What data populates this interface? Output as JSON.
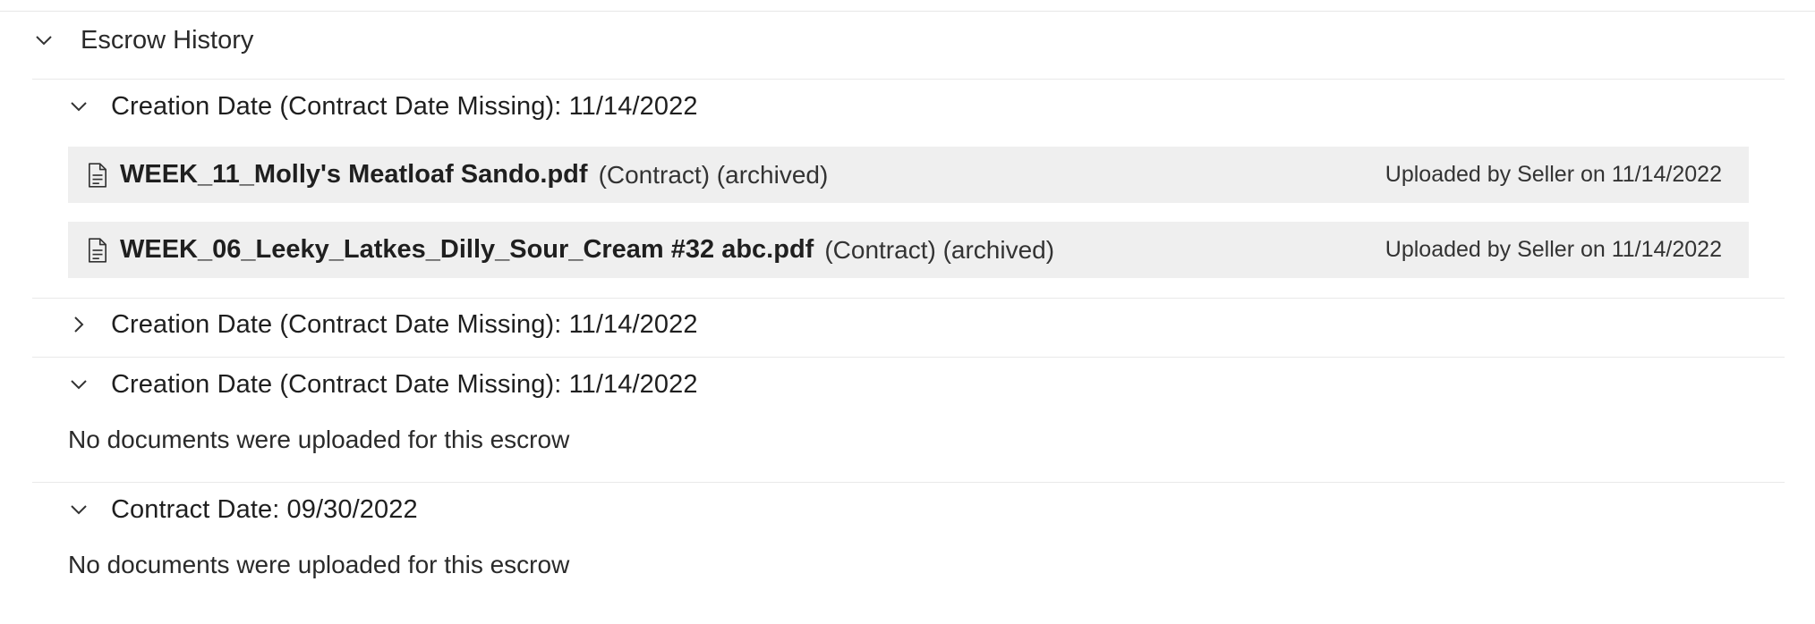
{
  "escrow_history": {
    "title": "Escrow History",
    "groups": [
      {
        "title": "Creation Date (Contract Date Missing): 11/14/2022",
        "expanded": true,
        "files": [
          {
            "name": "WEEK_11_Molly's Meatloaf Sando.pdf",
            "meta": "(Contract) (archived)",
            "uploaded": "Uploaded by Seller on 11/14/2022"
          },
          {
            "name": "WEEK_06_Leeky_Latkes_Dilly_Sour_Cream #32 abc.pdf",
            "meta": "(Contract) (archived)",
            "uploaded": "Uploaded by Seller on 11/14/2022"
          }
        ]
      },
      {
        "title": "Creation Date (Contract Date Missing): 11/14/2022",
        "expanded": false
      },
      {
        "title": "Creation Date (Contract Date Missing): 11/14/2022",
        "expanded": true,
        "empty_message": "No documents were uploaded for this escrow"
      },
      {
        "title": "Contract Date: 09/30/2022",
        "expanded": true,
        "empty_message": "No documents were uploaded for this escrow"
      }
    ]
  },
  "icons": {
    "section_toggle": "chevron-down-icon",
    "expanded_toggle": "chevron-down-icon",
    "collapsed_toggle": "chevron-right-icon",
    "file": "document-icon"
  }
}
